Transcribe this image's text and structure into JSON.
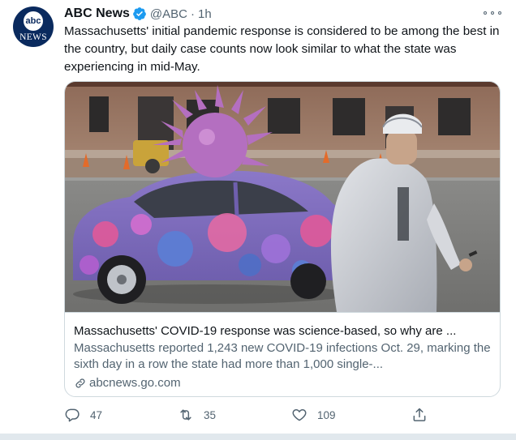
{
  "author": {
    "avatar_text_top": "abc",
    "avatar_text_bottom": "NEWS",
    "display_name": "ABC News",
    "handle": "@ABC",
    "separator": "·",
    "time": "1h",
    "verified": true
  },
  "tweet": {
    "text": "Massachusetts' initial pandemic response is considered to be among the best in the country, but daily case counts now look similar to what the state was experiencing in mid-May."
  },
  "card": {
    "title": "Massachusetts' COVID-19 response was science-based, so why are ...",
    "description": "Massachusetts reported 1,243 new COVID-19 infections Oct. 29, marking the sixth day in a row the state had more than 1,000 single-...",
    "domain": "abcnews.go.com",
    "image_alt_subject": "purple car painted with virus graphics and large virus sculpture on roof, man in hoodie walking by"
  },
  "actions": {
    "replies": "47",
    "retweets": "35",
    "likes": "109"
  },
  "colors": {
    "text_primary": "#0f1419",
    "text_secondary": "#536471",
    "verified_blue": "#1d9bf0",
    "border": "#cfd9de"
  },
  "icons": {
    "more": "more-icon",
    "verified": "verified-badge-icon",
    "reply": "reply-icon",
    "retweet": "retweet-icon",
    "like": "heart-icon",
    "share": "share-icon",
    "link": "link-icon"
  }
}
